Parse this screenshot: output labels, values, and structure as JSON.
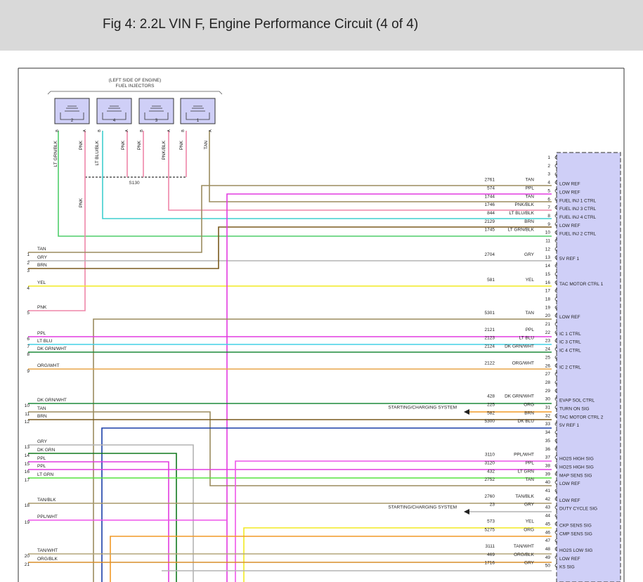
{
  "header": {
    "title": "Fig 4: 2.2L VIN F, Engine Performance Circuit (4 of 4)"
  },
  "injector_group": {
    "line1": "(LEFT SIDE OF ENGINE)",
    "line2": "FUEL INJECTORS"
  },
  "splice": "S130",
  "injectors": [
    {
      "num": "2",
      "pin_b": "B",
      "pin_a": "A",
      "wire_b": "LT GRN/BLK",
      "wire_a": "PNK"
    },
    {
      "num": "4",
      "pin_b": "B",
      "pin_a": "A",
      "wire_b": "LT BLU/BLK",
      "wire_a": "PNK"
    },
    {
      "num": "3",
      "pin_b": "B",
      "pin_a": "A",
      "wire_b": "PNK/BLK",
      "wire_a": "PNK"
    },
    {
      "num": "1",
      "pin_b": "B",
      "pin_a": "A",
      "wire_b": "TAN",
      "wire_a": "PNK"
    }
  ],
  "pnk_feed_label": "PNK",
  "ecm_pins": [
    "1",
    "2",
    "3",
    "4",
    "5",
    "6",
    "7",
    "8",
    "9",
    "10",
    "11",
    "12",
    "13",
    "14",
    "15",
    "16",
    "17",
    "18",
    "19",
    "20",
    "21",
    "22",
    "23",
    "24",
    "25",
    "26",
    "27",
    "28",
    "29",
    "30",
    "31",
    "32",
    "33",
    "34",
    "35",
    "36",
    "37",
    "38",
    "39",
    "40",
    "41",
    "42",
    "43",
    "44",
    "45",
    "46",
    "47",
    "48",
    "49",
    "50"
  ],
  "circuits": [
    {
      "pin": "4",
      "num": "2761",
      "color": "TAN",
      "func": "LOW REF"
    },
    {
      "pin": "5",
      "num": "574",
      "color": "PPL",
      "func": "LOW REF"
    },
    {
      "pin": "6",
      "num": "1744",
      "color": "TAN",
      "func": "FUEL INJ 1 CTRL"
    },
    {
      "pin": "7",
      "num": "1746",
      "color": "PNK/BLK",
      "func": "FUEL INJ 3 CTRL"
    },
    {
      "pin": "8",
      "num": "844",
      "color": "LT BLU/BLK",
      "func": "FUEL INJ 4 CTRL"
    },
    {
      "pin": "9",
      "num": "2129",
      "color": "BRN",
      "func": "LOW REF"
    },
    {
      "pin": "10",
      "num": "1745",
      "color": "LT GRN/BLK",
      "func": "FUEL INJ 2 CTRL"
    },
    {
      "pin": "13",
      "num": "2704",
      "color": "GRY",
      "func": "5V REF 1"
    },
    {
      "pin": "16",
      "num": "581",
      "color": "YEL",
      "func": "TAC MOTOR CTRL 1"
    },
    {
      "pin": "20",
      "num": "5301",
      "color": "TAN",
      "func": "LOW REF"
    },
    {
      "pin": "22",
      "num": "2121",
      "color": "PPL",
      "func": "IC 1 CTRL"
    },
    {
      "pin": "23",
      "num": "2123",
      "color": "LT BLU",
      "func": "IC 3 CTRL"
    },
    {
      "pin": "24",
      "num": "2124",
      "color": "DK GRN/WHT",
      "func": "IC 4 CTRL"
    },
    {
      "pin": "26",
      "num": "2122",
      "color": "ORG/WHT",
      "func": "IC 2 CTRL"
    },
    {
      "pin": "30",
      "num": "428",
      "color": "DK GRN/WHT",
      "func": "EVAP SOL CTRL"
    },
    {
      "pin": "31",
      "num": "225",
      "color": "ORG",
      "func": "TURN ON SIG"
    },
    {
      "pin": "32",
      "num": "582",
      "color": "BRN",
      "func": "TAC MOTOR CTRL 2"
    },
    {
      "pin": "33",
      "num": "5300",
      "color": "DK BLU",
      "func": "5V REF 1"
    },
    {
      "pin": "37",
      "num": "3110",
      "color": "PPL/WHT",
      "func": "HO2S HIGH SIG"
    },
    {
      "pin": "38",
      "num": "3120",
      "color": "PPL",
      "func": "HO2S HIGH SIG"
    },
    {
      "pin": "39",
      "num": "432",
      "color": "LT GRN",
      "func": "MAP SENS SIG"
    },
    {
      "pin": "40",
      "num": "2752",
      "color": "TAN",
      "func": "LOW REF"
    },
    {
      "pin": "42",
      "num": "2760",
      "color": "TAN/BLK",
      "func": "LOW REF"
    },
    {
      "pin": "43",
      "num": "23",
      "color": "GRY",
      "func": "DUTY CYCLE SIG"
    },
    {
      "pin": "45",
      "num": "573",
      "color": "YEL",
      "func": "CKP SENS SIG"
    },
    {
      "pin": "46",
      "num": "5275",
      "color": "ORG",
      "func": "CMP SENS SIG"
    },
    {
      "pin": "48",
      "num": "3111",
      "color": "TAN/WHT",
      "func": "HO2S LOW SIG"
    },
    {
      "pin": "49",
      "num": "469",
      "color": "ORG/BLK",
      "func": "LOW REF"
    },
    {
      "pin": "50",
      "num": "1716",
      "color": "GRY",
      "func": "KS SIG"
    }
  ],
  "arrow_labels": [
    {
      "pin": "31",
      "text": "STARTING/CHARGING SYSTEM"
    },
    {
      "pin": "43",
      "text": "STARTING/CHARGING SYSTEM"
    }
  ],
  "left_connector": [
    {
      "num": "1",
      "label": "TAN"
    },
    {
      "num": "2",
      "label": "GRY"
    },
    {
      "num": "3",
      "label": "BRN"
    },
    {
      "num": "4",
      "label": "YEL"
    },
    {
      "num": "5",
      "label": "PNK"
    },
    {
      "num": "6",
      "label": "PPL"
    },
    {
      "num": "7",
      "label": "LT BLU"
    },
    {
      "num": "8",
      "label": "DK GRN/WHT"
    },
    {
      "num": "9",
      "label": "ORG/WHT"
    },
    {
      "num": "10",
      "label": "DK GRN/WHT"
    },
    {
      "num": "11",
      "label": "TAN"
    },
    {
      "num": "12",
      "label": "BRN"
    },
    {
      "num": "13",
      "label": "GRY"
    },
    {
      "num": "14",
      "label": "DK GRN"
    },
    {
      "num": "15",
      "label": "PPL"
    },
    {
      "num": "16",
      "label": "PPL"
    },
    {
      "num": "17",
      "label": "LT GRN"
    },
    {
      "num": "18",
      "label": "TAN/BLK"
    },
    {
      "num": "19",
      "label": "PPL/WHT"
    },
    {
      "num": "20",
      "label": "TAN/WHT"
    },
    {
      "num": "21",
      "label": "ORG/BLK"
    }
  ],
  "colors": {
    "TAN": "#9b8c5e",
    "PPL": "#e23be0",
    "PNK": "#ef86a8",
    "PNK/BLK": "#ef86a8",
    "LT BLU/BLK": "#3fcfcf",
    "LT GRN/BLK": "#4fce6a",
    "BRN": "#7a5a1e",
    "GRY": "#b4b4b4",
    "YEL": "#f2ea22",
    "LT BLU": "#43d2e6",
    "DK GRN/WHT": "#1d8a3a",
    "ORG/WHT": "#e9a54a",
    "ORG": "#f29a26",
    "DK BLU": "#1a3fa8",
    "PPL/WHT": "#ee55ea",
    "LT GRN": "#55e43f",
    "TAN/BLK": "#a8996b",
    "TAN/WHT": "#b3a57a",
    "ORG/BLK": "#d88f2c",
    "DK GRN": "#127a1e",
    "ecm_fill": "#cfcff7"
  }
}
